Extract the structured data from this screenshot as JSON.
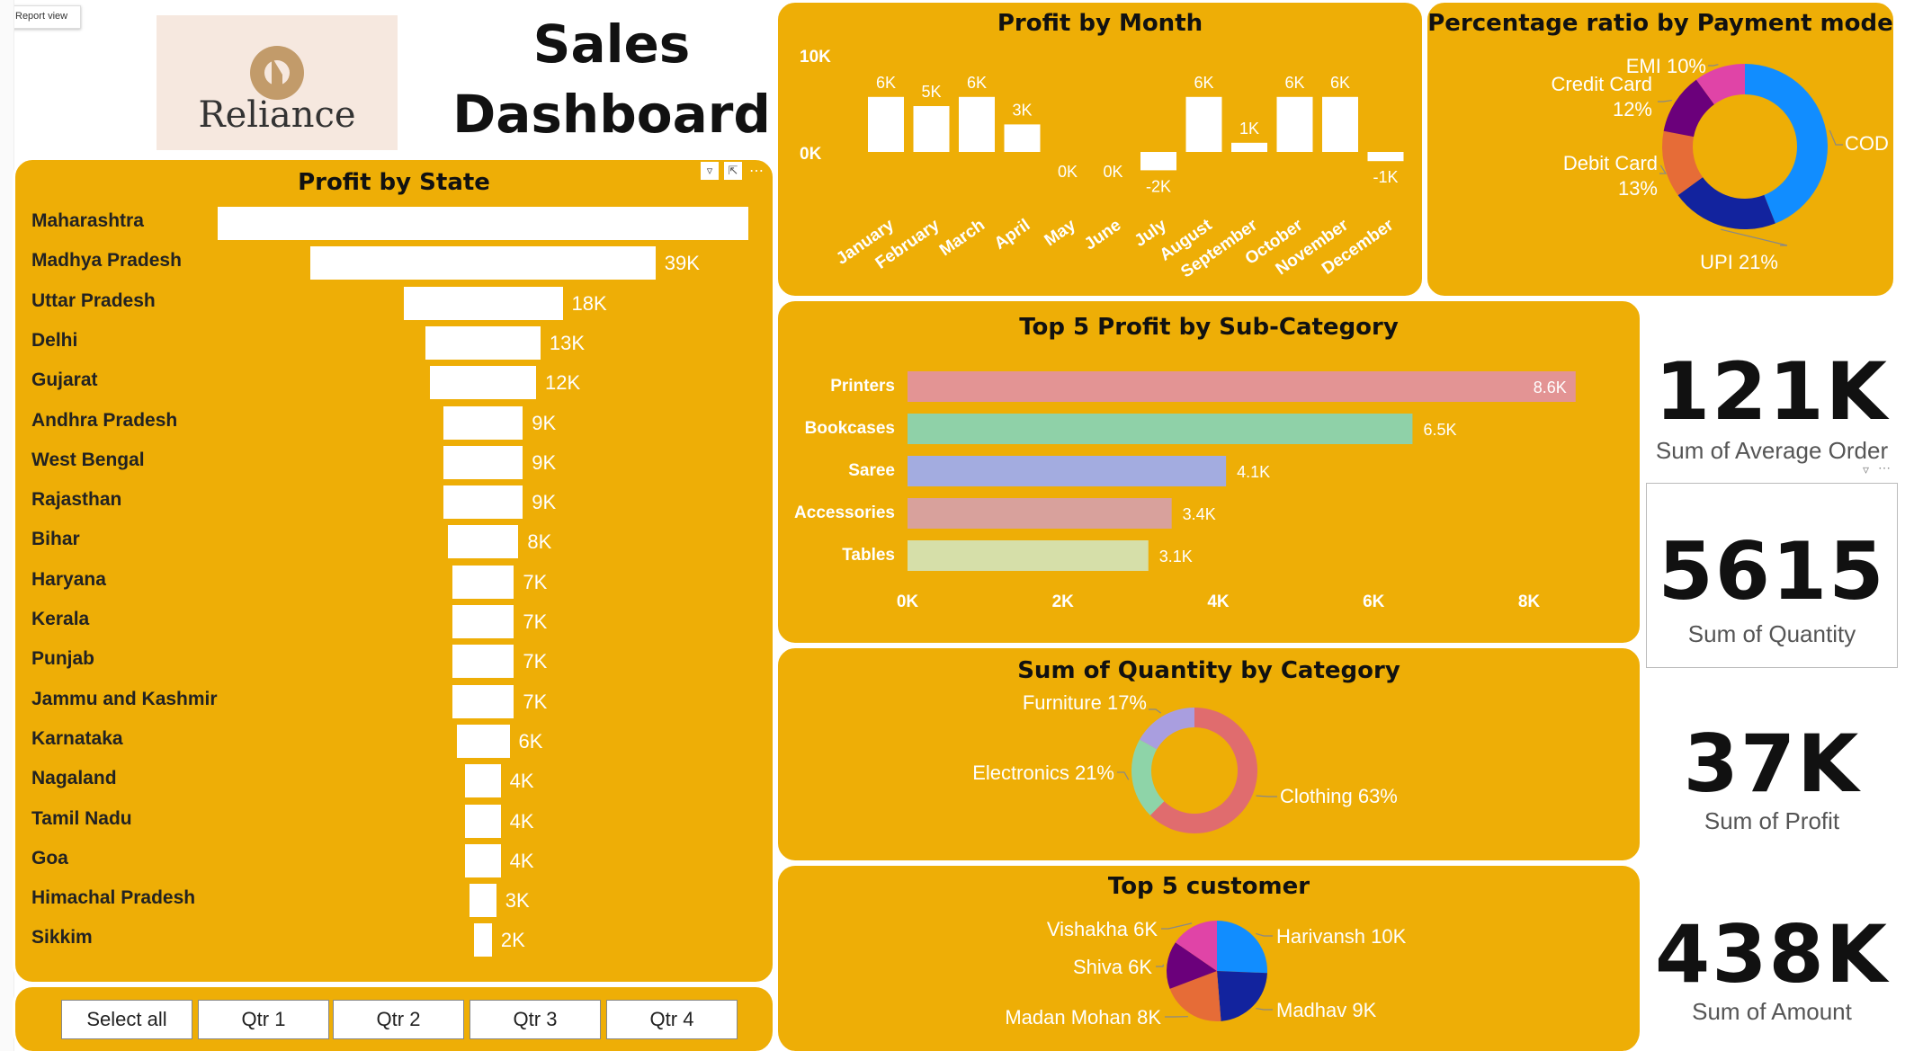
{
  "report_view_tab": "Report view",
  "logo_text": "Reliance",
  "title_line1": "Sales",
  "title_line2": "Dashboard",
  "colors": {
    "panel": "#EEAE06",
    "white": "#FFFFFF"
  },
  "state_chart": {
    "title": "Profit by State",
    "items": [
      {
        "state": "Maharashtra",
        "value": 60,
        "label": ""
      },
      {
        "state": "Madhya Pradesh",
        "value": 39,
        "label": "39K"
      },
      {
        "state": "Uttar Pradesh",
        "value": 18,
        "label": "18K"
      },
      {
        "state": "Delhi",
        "value": 13,
        "label": "13K"
      },
      {
        "state": "Gujarat",
        "value": 12,
        "label": "12K"
      },
      {
        "state": "Andhra Pradesh",
        "value": 9,
        "label": "9K"
      },
      {
        "state": "West Bengal",
        "value": 9,
        "label": "9K"
      },
      {
        "state": "Rajasthan",
        "value": 9,
        "label": "9K"
      },
      {
        "state": "Bihar",
        "value": 8,
        "label": "8K"
      },
      {
        "state": "Haryana",
        "value": 7,
        "label": "7K"
      },
      {
        "state": "Kerala",
        "value": 7,
        "label": "7K"
      },
      {
        "state": "Punjab",
        "value": 7,
        "label": "7K"
      },
      {
        "state": "Jammu and Kashmir",
        "value": 7,
        "label": "7K"
      },
      {
        "state": "Karnataka",
        "value": 6,
        "label": "6K"
      },
      {
        "state": "Nagaland",
        "value": 4,
        "label": "4K"
      },
      {
        "state": "Tamil Nadu",
        "value": 4,
        "label": "4K"
      },
      {
        "state": "Goa",
        "value": 4,
        "label": "4K"
      },
      {
        "state": "Himachal Pradesh",
        "value": 3,
        "label": "3K"
      },
      {
        "state": "Sikkim",
        "value": 2,
        "label": "2K"
      }
    ]
  },
  "slicer": {
    "buttons": [
      "Select all",
      "Qtr 1",
      "Qtr 2",
      "Qtr 3",
      "Qtr 4"
    ]
  },
  "month_chart": {
    "title": "Profit by Month",
    "ytick_top": "10K",
    "ytick_zero": "0K",
    "items": [
      {
        "month": "January",
        "value": 6,
        "label": "6K"
      },
      {
        "month": "February",
        "value": 5,
        "label": "5K"
      },
      {
        "month": "March",
        "value": 6,
        "label": "6K"
      },
      {
        "month": "April",
        "value": 3,
        "label": "3K"
      },
      {
        "month": "May",
        "value": 0,
        "label": "0K"
      },
      {
        "month": "June",
        "value": 0,
        "label": "0K"
      },
      {
        "month": "July",
        "value": -2,
        "label": "-2K"
      },
      {
        "month": "August",
        "value": 6,
        "label": "6K"
      },
      {
        "month": "September",
        "value": 1,
        "label": "1K"
      },
      {
        "month": "October",
        "value": 6,
        "label": "6K"
      },
      {
        "month": "November",
        "value": 6,
        "label": "6K"
      },
      {
        "month": "December",
        "value": -1,
        "label": "-1K"
      }
    ]
  },
  "payment_chart": {
    "title": "Percentage ratio by Payment mode",
    "items": [
      {
        "name": "COD",
        "pct": 44,
        "label": "COD 44%",
        "color": "#118DFF"
      },
      {
        "name": "UPI",
        "pct": 21,
        "label": "UPI 21%",
        "color": "#12239E"
      },
      {
        "name": "Debit Card",
        "pct": 13,
        "label": "Debit Card 13%",
        "color": "#E66C37"
      },
      {
        "name": "Credit Card",
        "pct": 12,
        "label": "Credit Card 12%",
        "color": "#6B007B"
      },
      {
        "name": "EMI",
        "pct": 10,
        "label": "EMI 10%",
        "color": "#E044A7"
      }
    ]
  },
  "subcat_chart": {
    "title": "Top 5 Profit by Sub-Category",
    "xticks": [
      "0K",
      "2K",
      "4K",
      "6K",
      "8K"
    ],
    "items": [
      {
        "name": "Printers",
        "value": 8.6,
        "label": "8.6K",
        "color": "#E39494"
      },
      {
        "name": "Bookcases",
        "value": 6.5,
        "label": "6.5K",
        "color": "#8FD1A8"
      },
      {
        "name": "Saree",
        "value": 4.1,
        "label": "4.1K",
        "color": "#A3ACE0"
      },
      {
        "name": "Accessories",
        "value": 3.4,
        "label": "3.4K",
        "color": "#D8A19C"
      },
      {
        "name": "Tables",
        "value": 3.1,
        "label": "3.1K",
        "color": "#D6DFA9"
      }
    ]
  },
  "category_chart": {
    "title": "Sum of Quantity by Category",
    "items": [
      {
        "name": "Clothing",
        "pct": 63,
        "label": "Clothing 63%",
        "color": "#E06C6E"
      },
      {
        "name": "Electronics",
        "pct": 21,
        "label": "Electronics 21%",
        "color": "#8ED4A8"
      },
      {
        "name": "Furniture",
        "pct": 17,
        "label": "Furniture 17%",
        "color": "#A99EDF"
      }
    ]
  },
  "customer_chart": {
    "title": "Top 5 customer",
    "items": [
      {
        "name": "Harivansh",
        "value": 10,
        "label": "Harivansh 10K",
        "color": "#118DFF"
      },
      {
        "name": "Madhav",
        "value": 9,
        "label": "Madhav 9K",
        "color": "#12239E"
      },
      {
        "name": "Madan Mohan",
        "value": 8,
        "label": "Madan Mohan 8K",
        "color": "#E66C37"
      },
      {
        "name": "Shiva",
        "value": 6,
        "label": "Shiva 6K",
        "color": "#6B007B"
      },
      {
        "name": "Vishakha",
        "value": 6,
        "label": "Vishakha 6K",
        "color": "#E044A7"
      }
    ]
  },
  "kpis": [
    {
      "value": "121K",
      "label": "Sum of Average Order"
    },
    {
      "value": "5615",
      "label": "Sum of Quantity"
    },
    {
      "value": "37K",
      "label": "Sum of Profit"
    },
    {
      "value": "438K",
      "label": "Sum of Amount"
    }
  ],
  "chart_data": [
    {
      "type": "bar",
      "title": "Profit by State",
      "orientation": "horizontal",
      "categories": [
        "Maharashtra",
        "Madhya Pradesh",
        "Uttar Pradesh",
        "Delhi",
        "Gujarat",
        "Andhra Pradesh",
        "West Bengal",
        "Rajasthan",
        "Bihar",
        "Haryana",
        "Kerala",
        "Punjab",
        "Jammu and Kashmir",
        "Karnataka",
        "Nagaland",
        "Tamil Nadu",
        "Goa",
        "Himachal Pradesh",
        "Sikkim"
      ],
      "values": [
        60,
        39,
        18,
        13,
        12,
        9,
        9,
        9,
        8,
        7,
        7,
        7,
        7,
        6,
        4,
        4,
        4,
        3,
        2
      ],
      "unit": "K"
    },
    {
      "type": "bar",
      "title": "Profit by Month",
      "categories": [
        "January",
        "February",
        "March",
        "April",
        "May",
        "June",
        "July",
        "August",
        "September",
        "October",
        "November",
        "December"
      ],
      "values": [
        6,
        5,
        6,
        3,
        0,
        0,
        -2,
        6,
        1,
        6,
        6,
        -1
      ],
      "unit": "K",
      "ylim": [
        -2,
        10
      ]
    },
    {
      "type": "pie",
      "title": "Percentage ratio by Payment mode",
      "donut": true,
      "categories": [
        "COD",
        "UPI",
        "Debit Card",
        "Credit Card",
        "EMI"
      ],
      "values": [
        44,
        21,
        13,
        12,
        10
      ],
      "unit": "%"
    },
    {
      "type": "bar",
      "title": "Top 5 Profit by Sub-Category",
      "orientation": "horizontal",
      "categories": [
        "Printers",
        "Bookcases",
        "Saree",
        "Accessories",
        "Tables"
      ],
      "values": [
        8.6,
        6.5,
        4.1,
        3.4,
        3.1
      ],
      "unit": "K",
      "xlim": [
        0,
        8
      ]
    },
    {
      "type": "pie",
      "title": "Sum of Quantity by Category",
      "donut": true,
      "categories": [
        "Clothing",
        "Electronics",
        "Furniture"
      ],
      "values": [
        63,
        21,
        17
      ],
      "unit": "%"
    },
    {
      "type": "pie",
      "title": "Top 5 customer",
      "categories": [
        "Harivansh",
        "Madhav",
        "Madan Mohan",
        "Shiva",
        "Vishakha"
      ],
      "values": [
        10,
        9,
        8,
        6,
        6
      ],
      "unit": "K"
    }
  ]
}
